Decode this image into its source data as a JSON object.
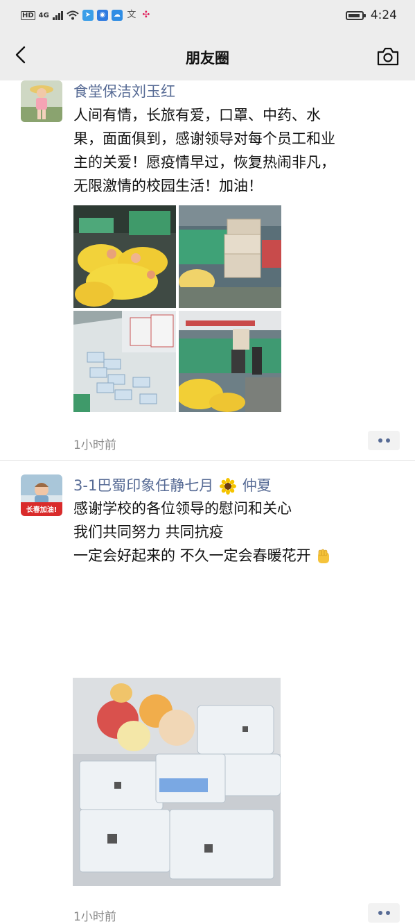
{
  "status_bar": {
    "network_tags": [
      "HD",
      "4G"
    ],
    "time": "4:24",
    "notification_icons": [
      "telegram-icon",
      "bulb-icon",
      "cloud-icon",
      "translate-icon",
      "slack-icon"
    ]
  },
  "nav": {
    "title": "朋友圈",
    "back_icon": "chevron-left-icon",
    "camera_icon": "camera-icon",
    "background": "#ededed"
  },
  "posts": [
    {
      "author": "食堂保洁刘玉红",
      "text_lines": [
        "人间有情，长旅有爱，口罩、中药、水",
        "果，面面俱到，感谢领导对每个员工和业",
        "主的关爱！愿疫情早过，恢复热闹非凡，",
        "无限激情的校园生活！加油！"
      ],
      "photos": [
        "fruit-bags-photo",
        "boxes-photo",
        "masks-table-photo",
        "canteen-delivery-photo"
      ],
      "time": "1小时前"
    },
    {
      "author": "3-1巴蜀印象任静七月",
      "author_emoji": "sunflower-icon",
      "author_suffix": "仲夏",
      "avatar_caption": "长春加油!",
      "text_lines": [
        "感谢学校的各位领导的慰问和关心",
        "我们共同努力  共同抗疫",
        "一定会好起来的  不久一定会春暖花开"
      ],
      "text_emoji": "fist-emoji",
      "photos": [
        "fruit-and-medicine-photo"
      ],
      "time": "1小时前"
    }
  ],
  "colors": {
    "name_link": "#576b95",
    "timestamp": "#8a8a8a",
    "divider": "#e6e6e6"
  }
}
